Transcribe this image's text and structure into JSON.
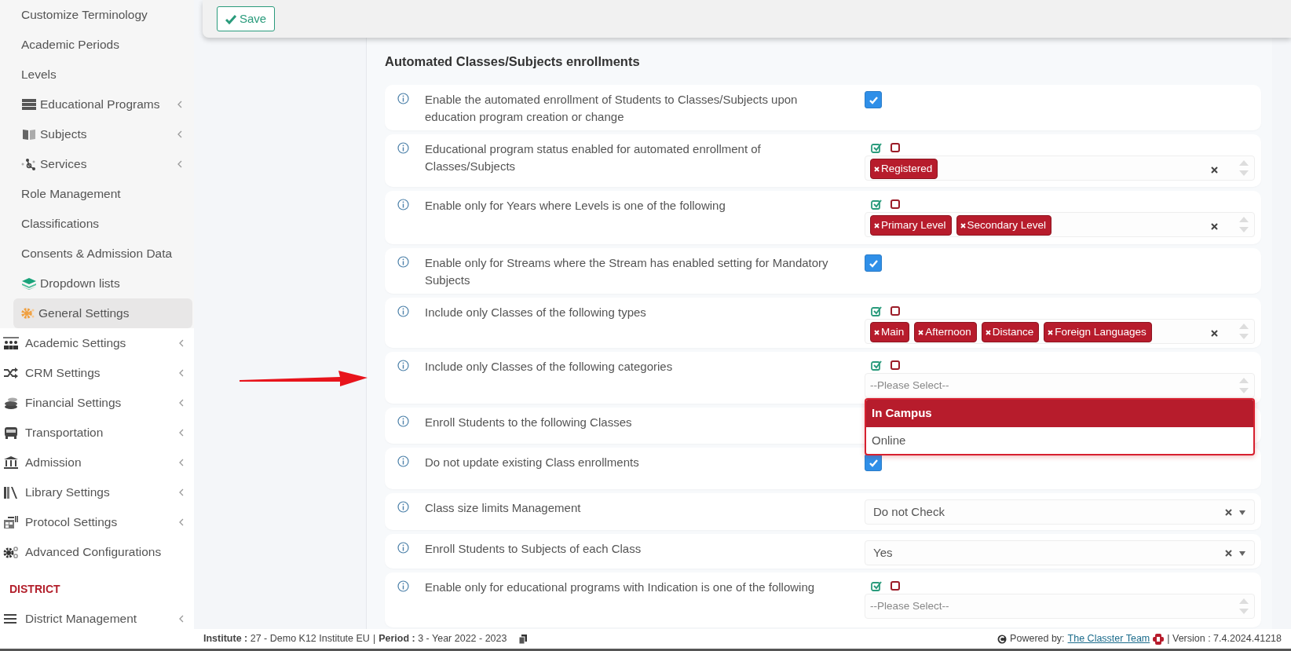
{
  "toolbar": {
    "save_label": "Save"
  },
  "sidebar": {
    "items": [
      {
        "label": "Customize Terminology",
        "kind": "sub",
        "has_submenu": false,
        "selected": false
      },
      {
        "label": "Academic Periods",
        "kind": "sub",
        "has_submenu": false,
        "selected": false
      },
      {
        "label": "Levels",
        "kind": "sub",
        "has_submenu": false,
        "selected": false
      },
      {
        "label": "Educational Programs",
        "kind": "sub",
        "has_submenu": true,
        "selected": false
      },
      {
        "label": "Subjects",
        "kind": "sub",
        "has_submenu": true,
        "selected": false
      },
      {
        "label": "Services",
        "kind": "sub",
        "has_submenu": true,
        "selected": false
      },
      {
        "label": "Role Management",
        "kind": "sub",
        "has_submenu": false,
        "selected": false
      },
      {
        "label": "Classifications",
        "kind": "sub",
        "has_submenu": false,
        "selected": false
      },
      {
        "label": "Consents & Admission Data",
        "kind": "sub",
        "has_submenu": false,
        "selected": false
      },
      {
        "label": "Dropdown lists",
        "kind": "sub",
        "has_submenu": false,
        "selected": false
      },
      {
        "label": "General Settings",
        "kind": "sub",
        "has_submenu": false,
        "selected": true
      },
      {
        "label": "Academic Settings",
        "kind": "main",
        "has_submenu": true,
        "selected": false
      },
      {
        "label": "CRM Settings",
        "kind": "main",
        "has_submenu": true,
        "selected": false
      },
      {
        "label": "Financial Settings",
        "kind": "main",
        "has_submenu": true,
        "selected": false
      },
      {
        "label": "Transportation",
        "kind": "main",
        "has_submenu": true,
        "selected": false
      },
      {
        "label": "Admission",
        "kind": "main",
        "has_submenu": true,
        "selected": false
      },
      {
        "label": "Library Settings",
        "kind": "main",
        "has_submenu": true,
        "selected": false
      },
      {
        "label": "Protocol Settings",
        "kind": "main",
        "has_submenu": true,
        "selected": false
      },
      {
        "label": "Advanced Configurations",
        "kind": "main",
        "has_submenu": false,
        "selected": false
      },
      {
        "label": "DISTRICT",
        "kind": "heading"
      },
      {
        "label": "District Management",
        "kind": "main",
        "has_submenu": true,
        "selected": false
      }
    ]
  },
  "section": {
    "title": "Automated Classes/Subjects enrollments",
    "rows": [
      {
        "label": "Enable the automated enrollment of Students to Classes/Subjects upon education program creation or change",
        "kind": "checkbox",
        "checked": true
      },
      {
        "label": "Educational program status enabled for automated enrollment of Classes/Subjects",
        "kind": "multiselect",
        "tags": [
          "Registered"
        ]
      },
      {
        "label": "Enable only for Years where Levels is one of the following",
        "kind": "multiselect",
        "tags": [
          "Primary Level",
          "Secondary Level"
        ]
      },
      {
        "label": "Enable only for Streams where the Stream has enabled setting for Mandatory Subjects",
        "kind": "checkbox",
        "checked": true
      },
      {
        "label": "Include only Classes of the following types",
        "kind": "multiselect",
        "tags": [
          "Main",
          "Afternoon",
          "Distance",
          "Foreign Languages"
        ]
      },
      {
        "label": "Include only Classes of the following categories",
        "kind": "multiselect",
        "placeholder": "--Please Select--",
        "open_options": [
          {
            "label": "In Campus",
            "selected": true
          },
          {
            "label": "Online",
            "selected": false
          }
        ]
      },
      {
        "label": "Enroll Students to the following Classes",
        "kind": "covered"
      },
      {
        "label": "Do not update existing Class enrollments",
        "kind": "checkbox",
        "checked": true
      },
      {
        "label": "Class size limits Management",
        "kind": "select",
        "value": "Do not Check"
      },
      {
        "label": "Enroll Students to Subjects of each Class",
        "kind": "select",
        "value": "Yes"
      },
      {
        "label": "Enable only for educational programs with Indication is one of the following",
        "kind": "multiselect",
        "placeholder": "--Please Select--"
      }
    ]
  },
  "footer": {
    "institute_label": "Institute :",
    "institute": "27 - Demo K12 Institute EU",
    "separator": "|",
    "period_label": "Period :",
    "period": "3 - Year 2022 - 2023",
    "powered_by": "Powered by:",
    "team": "The Classter Team",
    "version": "| Version : 7.4.2024.41218"
  }
}
